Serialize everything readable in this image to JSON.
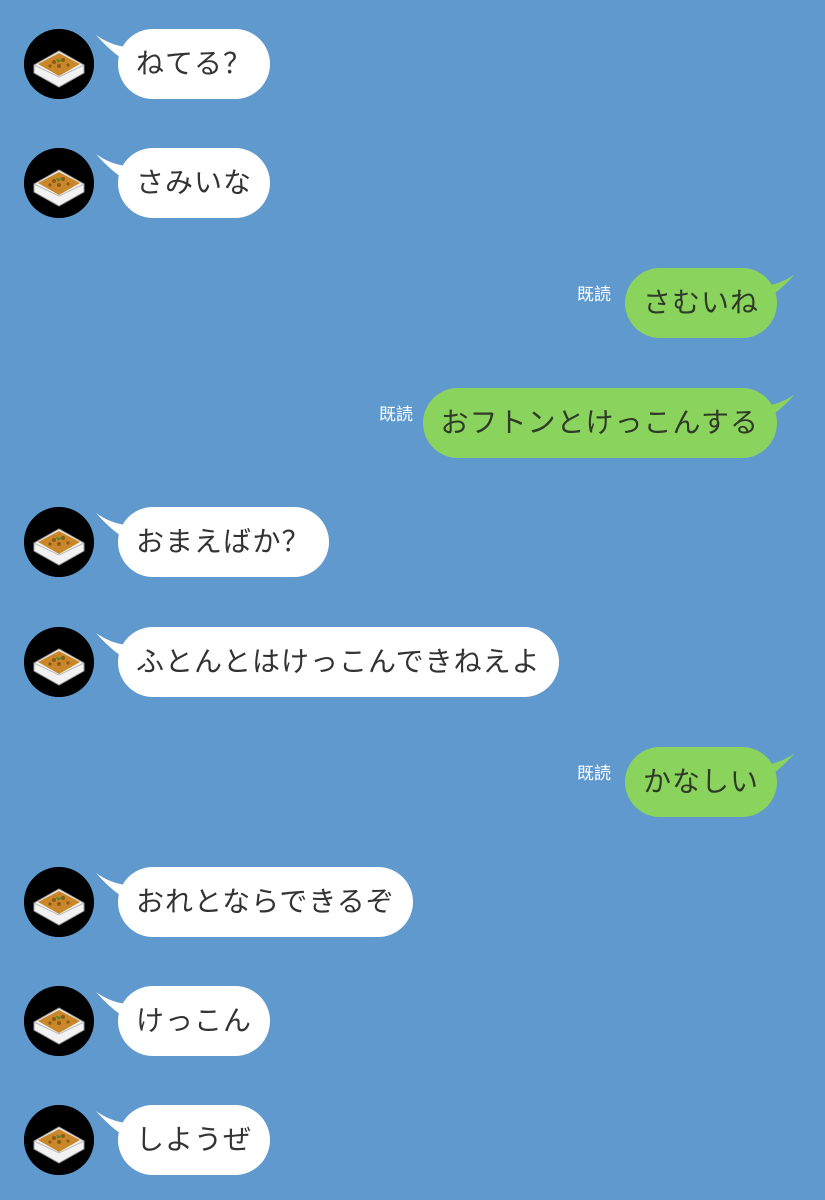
{
  "colors": {
    "background": "#5f99ce",
    "incoming_bubble": "#ffffff",
    "outgoing_bubble": "#8ad45d",
    "read_receipt": "#ffffff"
  },
  "avatar_icon": "natto-bowl-icon",
  "messages": [
    {
      "side": "in",
      "text": "ねてる？"
    },
    {
      "side": "in",
      "text": "さみいな"
    },
    {
      "side": "out",
      "text": "さむいね",
      "read": "既読"
    },
    {
      "side": "out",
      "text": "おフトンとけっこんする",
      "read": "既読"
    },
    {
      "side": "in",
      "text": "おまえばか？"
    },
    {
      "side": "in",
      "text": "ふとんとはけっこんできねえよ"
    },
    {
      "side": "out",
      "text": "かなしい",
      "read": "既読"
    },
    {
      "side": "in",
      "text": "おれとならできるぞ"
    },
    {
      "side": "in",
      "text": "けっこん"
    },
    {
      "side": "in",
      "text": "しようぜ"
    }
  ]
}
